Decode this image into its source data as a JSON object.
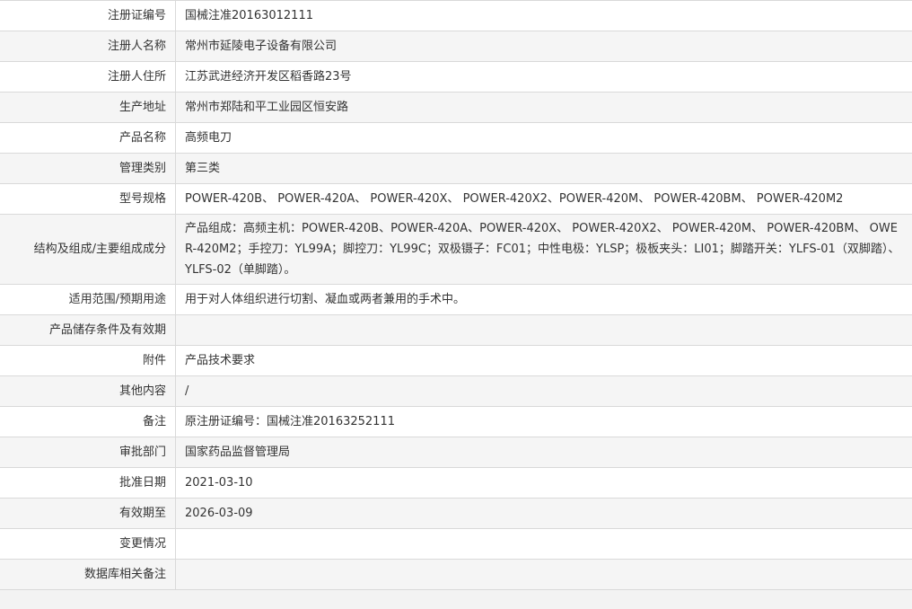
{
  "rows": [
    {
      "label": "注册证编号",
      "value": "国械注准20163012111"
    },
    {
      "label": "注册人名称",
      "value": "常州市延陵电子设备有限公司"
    },
    {
      "label": "注册人住所",
      "value": "江苏武进经济开发区稻香路23号"
    },
    {
      "label": "生产地址",
      "value": "常州市郑陆和平工业园区恒安路"
    },
    {
      "label": "产品名称",
      "value": "高频电刀"
    },
    {
      "label": "管理类别",
      "value": "第三类"
    },
    {
      "label": "型号规格",
      "value": "POWER-420B、 POWER-420A、 POWER-420X、 POWER-420X2、POWER-420M、 POWER-420BM、 POWER-420M2"
    },
    {
      "label": "结构及组成/主要组成成分",
      "value": "产品组成：高频主机：POWER-420B、POWER-420A、POWER-420X、 POWER-420X2、 POWER-420M、 POWER-420BM、 OWER-420M2；手控刀：YL99A；脚控刀：YL99C；双极镊子：FC01；中性电极：YLSP；极板夹头：LI01；脚踏开关：YLFS-01（双脚踏）、YLFS-02（单脚踏）。"
    },
    {
      "label": "适用范围/预期用途",
      "value": "用于对人体组织进行切割、凝血或两者兼用的手术中。"
    },
    {
      "label": "产品储存条件及有效期",
      "value": ""
    },
    {
      "label": "附件",
      "value": "产品技术要求"
    },
    {
      "label": "其他内容",
      "value": "/"
    },
    {
      "label": "备注",
      "value": "原注册证编号：国械注准20163252111"
    },
    {
      "label": "审批部门",
      "value": "国家药品监督管理局"
    },
    {
      "label": "批准日期",
      "value": "2021-03-10"
    },
    {
      "label": "有效期至",
      "value": "2026-03-09"
    },
    {
      "label": "变更情况",
      "value": ""
    },
    {
      "label": "数据库相关备注",
      "value": ""
    }
  ]
}
